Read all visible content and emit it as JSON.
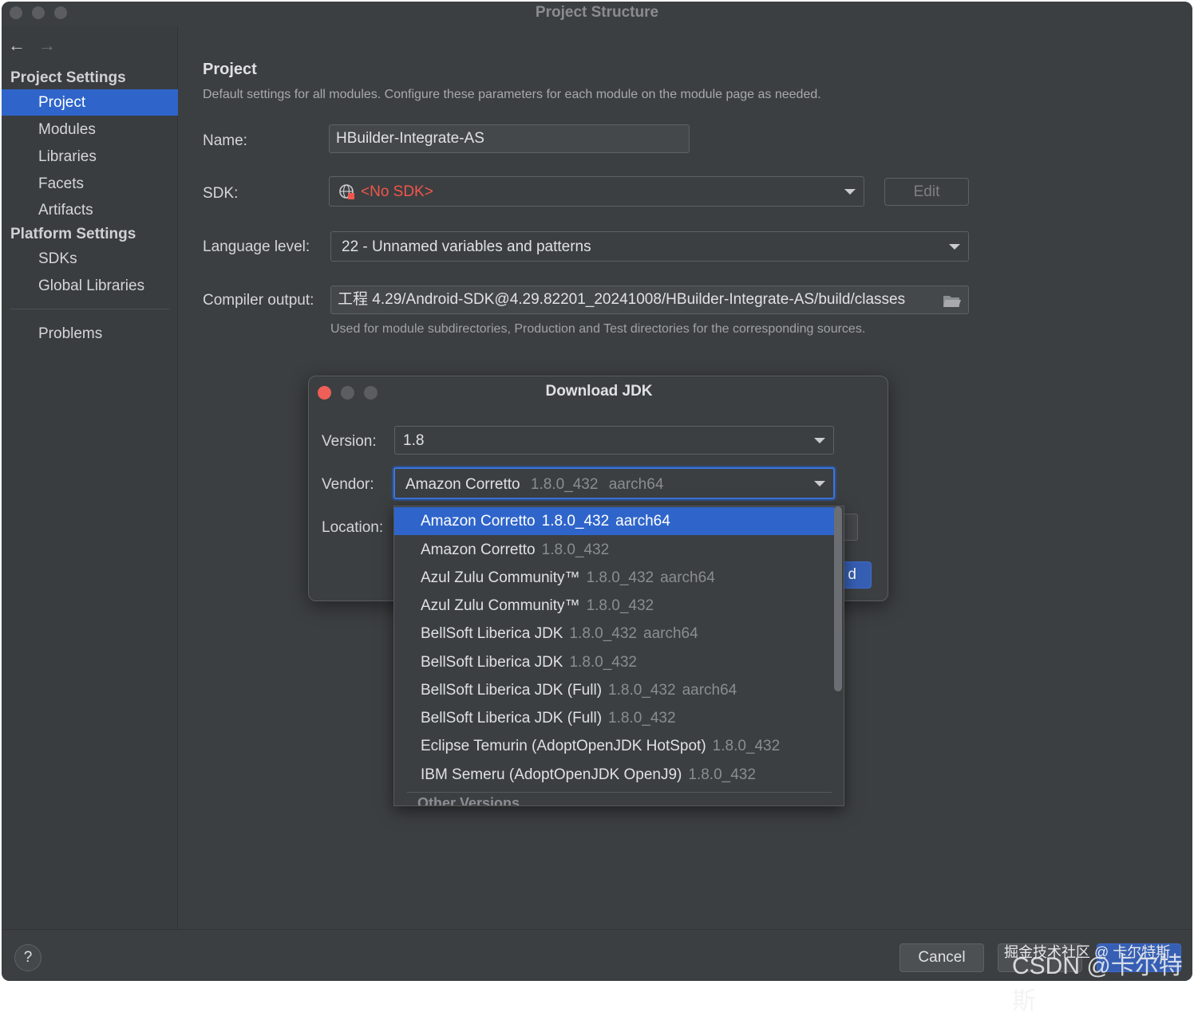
{
  "window": {
    "title": "Project Structure"
  },
  "sidebar": {
    "project_settings_header": "Project Settings",
    "project_items": [
      "Project",
      "Modules",
      "Libraries",
      "Facets",
      "Artifacts"
    ],
    "platform_settings_header": "Platform Settings",
    "platform_items": [
      "SDKs",
      "Global Libraries"
    ],
    "problems": "Problems"
  },
  "project": {
    "title": "Project",
    "description": "Default settings for all modules. Configure these parameters for each module on the module page as needed.",
    "name_label": "Name:",
    "name_value": "HBuilder-Integrate-AS",
    "sdk_label": "SDK:",
    "sdk_value": "<No SDK>",
    "sdk_edit": "Edit",
    "language_label": "Language level:",
    "language_value": "22 - Unnamed variables and patterns",
    "compiler_label": "Compiler output:",
    "compiler_value": "工程 4.29/Android-SDK@4.29.82201_20241008/HBuilder-Integrate-AS/build/classes",
    "compiler_hint": "Used for module subdirectories, Production and Test directories for the corresponding sources."
  },
  "dialog": {
    "title": "Download JDK",
    "version_label": "Version:",
    "version_value": "1.8",
    "vendor_label": "Vendor:",
    "vendor_name": "Amazon Corretto",
    "vendor_version": "1.8.0_432",
    "vendor_arch": "aarch64",
    "location_label": "Location:",
    "download_partial": "d"
  },
  "vendor_options": [
    {
      "name": "Amazon Corretto",
      "version": "1.8.0_432",
      "arch": "aarch64"
    },
    {
      "name": "Amazon Corretto",
      "version": "1.8.0_432",
      "arch": ""
    },
    {
      "name": "Azul Zulu Community™",
      "version": "1.8.0_432",
      "arch": "aarch64"
    },
    {
      "name": "Azul Zulu Community™",
      "version": "1.8.0_432",
      "arch": ""
    },
    {
      "name": "BellSoft Liberica JDK",
      "version": "1.8.0_432",
      "arch": "aarch64"
    },
    {
      "name": "BellSoft Liberica JDK",
      "version": "1.8.0_432",
      "arch": ""
    },
    {
      "name": "BellSoft Liberica JDK (Full)",
      "version": "1.8.0_432",
      "arch": "aarch64"
    },
    {
      "name": "BellSoft Liberica JDK (Full)",
      "version": "1.8.0_432",
      "arch": ""
    },
    {
      "name": "Eclipse Temurin (AdoptOpenJDK HotSpot)",
      "version": "1.8.0_432",
      "arch": ""
    },
    {
      "name": "IBM Semeru (AdoptOpenJDK OpenJ9)",
      "version": "1.8.0_432",
      "arch": ""
    }
  ],
  "vendor_group_other": "Other Versions",
  "footer": {
    "help": "?",
    "cancel": "Cancel",
    "watermark_small": "掘金技术社区 @ 卡尔特斯",
    "watermark_large": "CSDN @卡尔特斯"
  },
  "colors": {
    "accent": "#2f65ca",
    "error_text": "#f0564c",
    "background": "#3c3f41"
  }
}
